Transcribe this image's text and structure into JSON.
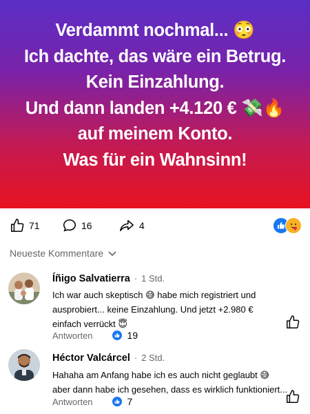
{
  "post": {
    "lines": [
      "Verdammt nochmal... 😳",
      "Ich dachte, das wäre ein Betrug.",
      "Kein Einzahlung.",
      "Und dann landen +4.120 € 💸🔥",
      "auf meinem Konto.",
      "Was für ein Wahnsinn!"
    ],
    "colors": {
      "top": "#5a2fc6",
      "bottom": "#e8121f"
    }
  },
  "actions": {
    "likes": "71",
    "comments": "16",
    "shares": "4",
    "like_icon": "thumbs-up-icon",
    "comment_icon": "speech-bubble-icon",
    "share_icon": "share-arrow-icon",
    "reactions": [
      "like-reaction-icon",
      "care-reaction-icon"
    ]
  },
  "sort": {
    "label": "Neueste Kommentare",
    "icon": "chevron-down-icon"
  },
  "comments": [
    {
      "name": "Íñigo Salvatierra",
      "time": "1 Std.",
      "line1": "Ich war auch skeptisch 😅 habe mich registriert und",
      "line2": "ausprobiert... keine Einzahlung. Und jetzt +2.980 €",
      "line3": "einfach verrückt 😇",
      "reply": "Antworten",
      "likes": "19"
    },
    {
      "name": "Héctor Valcárcel",
      "time": "2 Std.",
      "line1": "Hahaha am Anfang habe ich es auch nicht geglaubt 😅",
      "line2": "aber dann habe ich gesehen, dass es wirklich funktioniert...",
      "reply": "Antworten",
      "likes": "7"
    }
  ],
  "accent": "#1877f2"
}
